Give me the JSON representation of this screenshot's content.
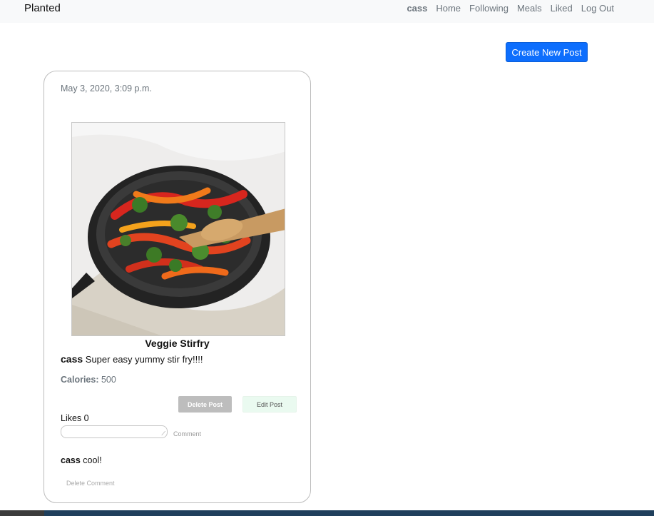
{
  "nav": {
    "brand": "Planted",
    "user": "cass",
    "links": [
      "Home",
      "Following",
      "Meals",
      "Liked",
      "Log Out"
    ]
  },
  "create_post_label": "Create New Post",
  "post": {
    "timestamp": "May 3, 2020, 3:09 p.m.",
    "image_icon": "veggie-stirfry-skillet-photo",
    "title": "Veggie Stirfry",
    "author": "cass",
    "caption": "Super easy yummy stir fry!!!!",
    "calories_label": "Calories:",
    "calories_value": "500",
    "delete_label": "Delete Post",
    "edit_label": "Edit Post",
    "likes_text": "Likes 0",
    "comment_input_value": "",
    "comment_button_label": "Comment",
    "comments": [
      {
        "author": "cass",
        "text": "cool!",
        "delete_label": "Delete Comment"
      }
    ]
  },
  "colors": {
    "primary": "#0d6efd",
    "navbar_bg": "#f8f9fa",
    "delete_btn": "#bdbdbd",
    "edit_btn": "#eafaf0"
  }
}
